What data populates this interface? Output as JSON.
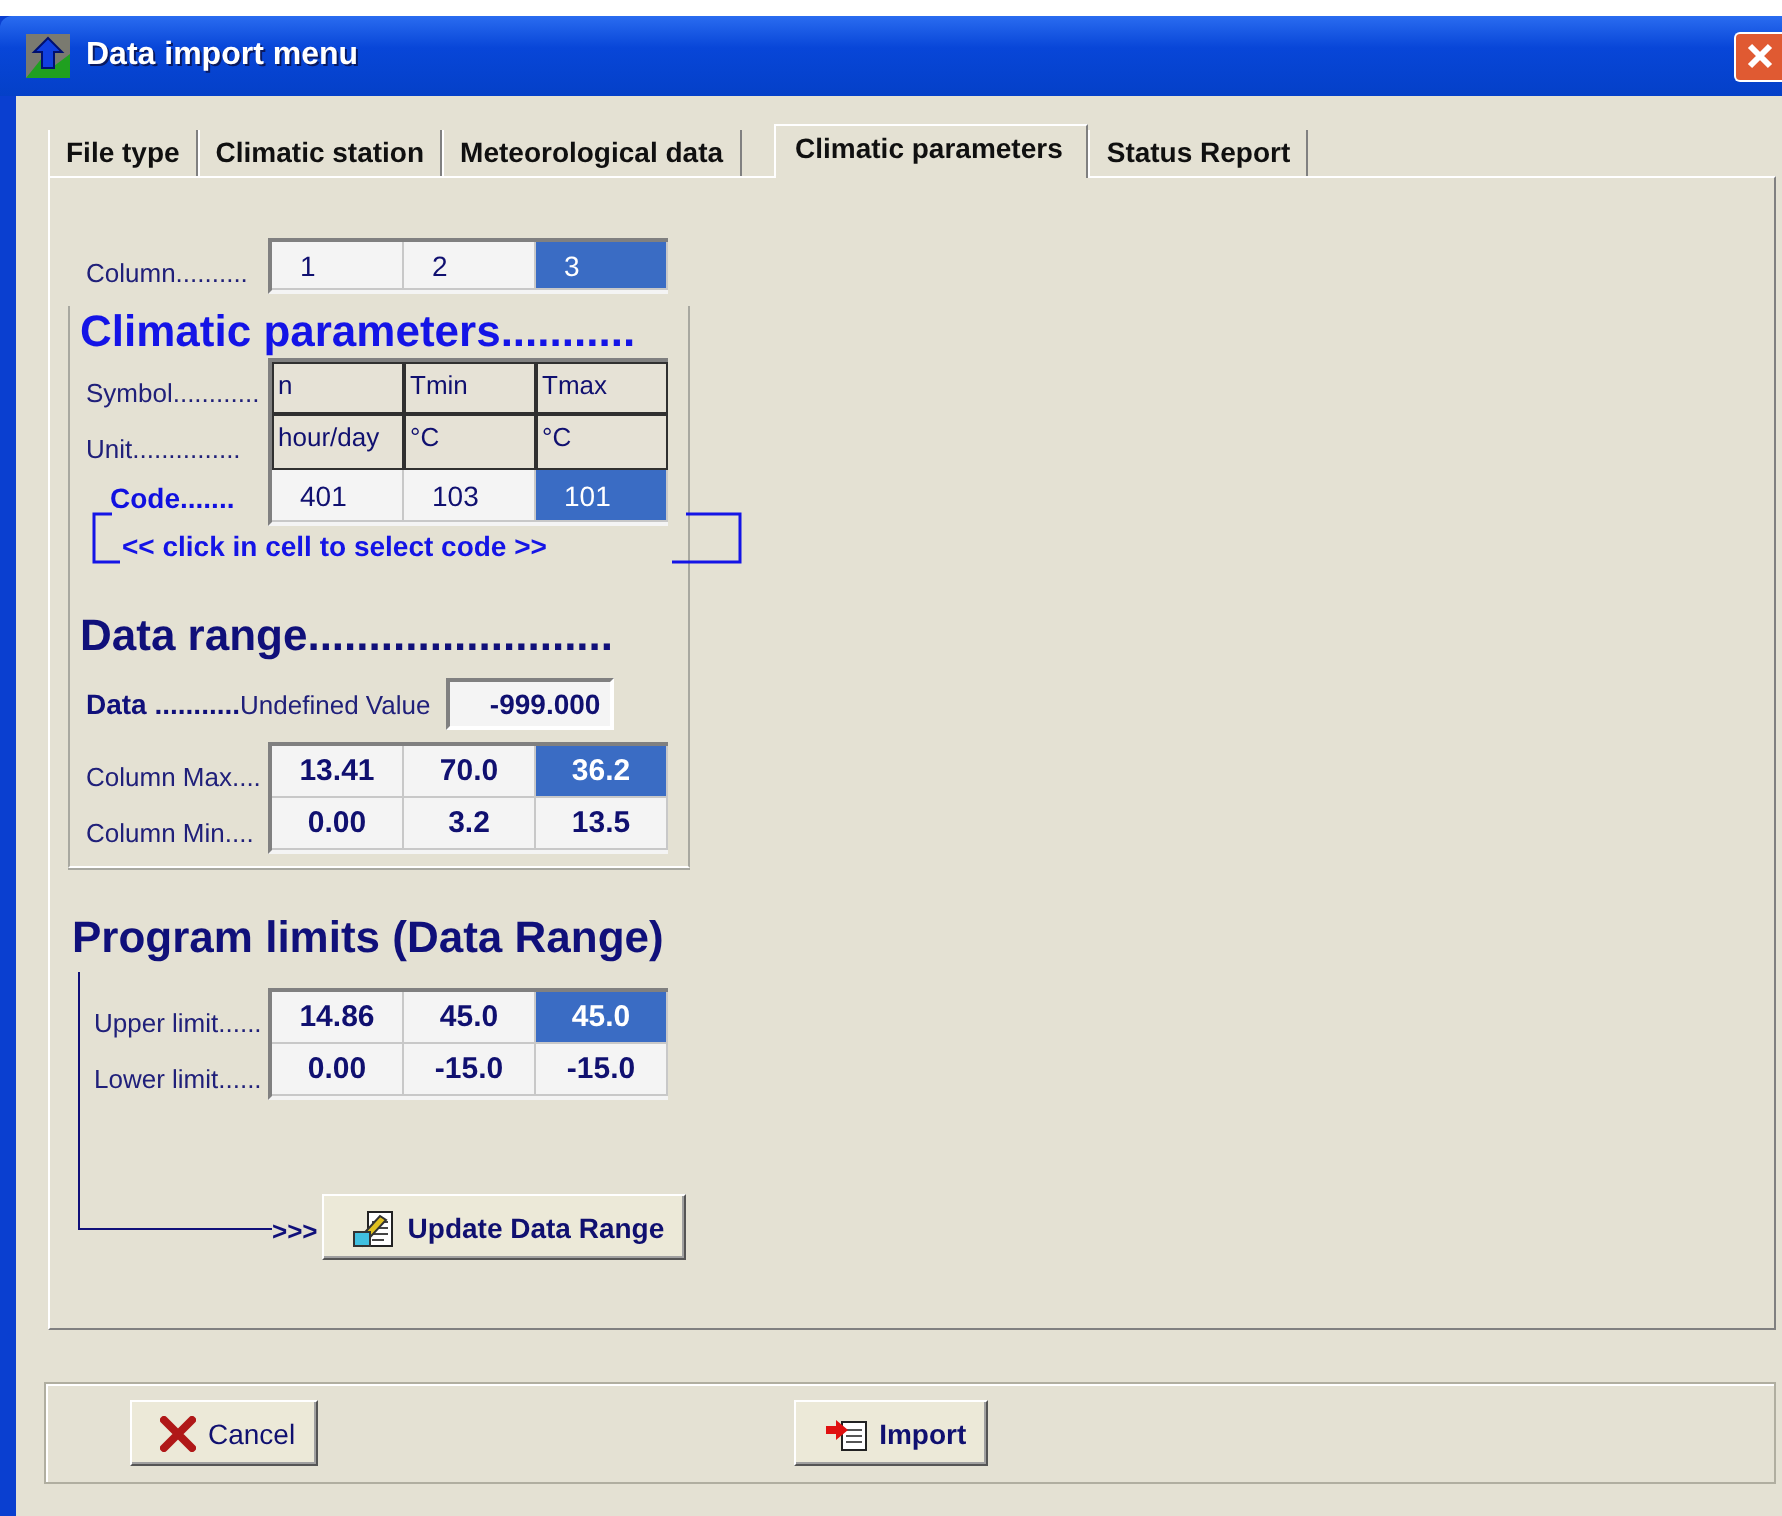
{
  "window": {
    "title": "Data import menu"
  },
  "tabs": [
    {
      "label": "File type",
      "selected": false
    },
    {
      "label": "Climatic station",
      "selected": false
    },
    {
      "label": "Meteorological data",
      "selected": false
    },
    {
      "label": "Climatic parameters",
      "selected": true
    },
    {
      "label": "Status Report",
      "selected": false
    }
  ],
  "column_selector": {
    "label": "Column..........",
    "cells": [
      {
        "text": "1",
        "selected": false
      },
      {
        "text": "2",
        "selected": false
      },
      {
        "text": "3",
        "selected": true
      }
    ]
  },
  "climatic_parameters": {
    "heading": "Climatic parameters...........",
    "rows": [
      {
        "kind": "header",
        "label": "Symbol............",
        "cells": [
          {
            "text": "n",
            "selected": false
          },
          {
            "text": "Tmin",
            "selected": false
          },
          {
            "text": "Tmax",
            "selected": false
          }
        ]
      },
      {
        "kind": "header",
        "label": "Unit...............",
        "cells": [
          {
            "text": "hour/day",
            "selected": false
          },
          {
            "text": "°C",
            "selected": false
          },
          {
            "text": "°C",
            "selected": false
          }
        ]
      },
      {
        "kind": "code",
        "label": "Code.......",
        "cells": [
          {
            "text": "401",
            "selected": false
          },
          {
            "text": "103",
            "selected": false
          },
          {
            "text": "101",
            "selected": true
          }
        ]
      }
    ],
    "hint": "<< click in cell to select code >>"
  },
  "data_range": {
    "heading": "Data range.........................",
    "data_label": "Data ...........",
    "undefined_label": "Undefined Value",
    "undefined_value": "-999.000",
    "rows": [
      {
        "kind": "value",
        "label": "Column Max....",
        "cells": [
          {
            "text": "13.41",
            "selected": false
          },
          {
            "text": "70.0",
            "selected": false
          },
          {
            "text": "36.2",
            "selected": true
          }
        ]
      },
      {
        "kind": "value",
        "label": "Column Min....",
        "cells": [
          {
            "text": "0.00",
            "selected": false
          },
          {
            "text": "3.2",
            "selected": false
          },
          {
            "text": "13.5",
            "selected": false
          }
        ]
      }
    ]
  },
  "program_limits": {
    "heading": "Program limits (Data Range)",
    "rows": [
      {
        "kind": "value",
        "label": "Upper limit......",
        "cells": [
          {
            "text": "14.86",
            "selected": false
          },
          {
            "text": "45.0",
            "selected": false
          },
          {
            "text": "45.0",
            "selected": true
          }
        ]
      },
      {
        "kind": "value",
        "label": "Lower limit......",
        "cells": [
          {
            "text": "0.00",
            "selected": false
          },
          {
            "text": "-15.0",
            "selected": false
          },
          {
            "text": "-15.0",
            "selected": false
          }
        ]
      }
    ],
    "arrow": ">>>",
    "update_button": "Update Data Range"
  },
  "buttons": [
    {
      "kind": "cancel",
      "label": "Cancel"
    },
    {
      "kind": "import",
      "label": "Import"
    }
  ]
}
